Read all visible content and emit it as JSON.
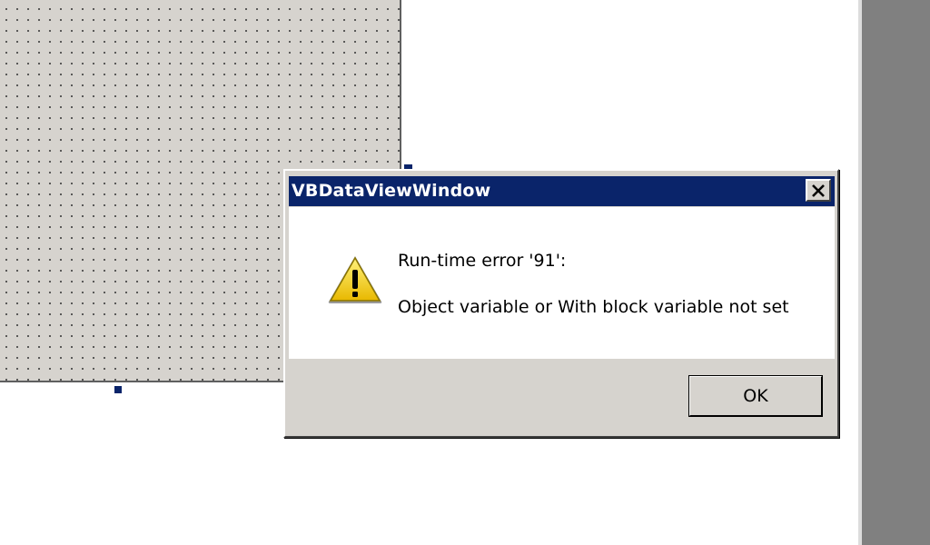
{
  "designer": {
    "grid_color": "#d6d3ce",
    "handle_color": "#0a246a"
  },
  "dialog": {
    "title": "VBDataViewWindow",
    "error_title": "Run-time error '91':",
    "error_message": "Object variable or With block variable not set",
    "ok_label": "OK",
    "icon": "warning-icon",
    "titlebar_color": "#0a246a"
  }
}
